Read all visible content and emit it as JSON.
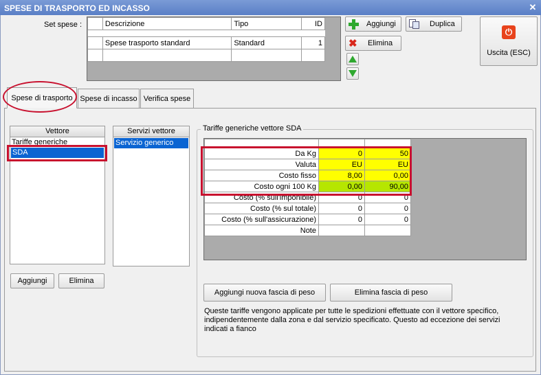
{
  "window": {
    "title": "SPESE DI TRASPORTO ED INCASSO",
    "close_glyph": "✕"
  },
  "set_spese": {
    "label": "Set spese :",
    "columns": [
      "Descrizione",
      "Tipo",
      "ID"
    ],
    "rows": [
      {
        "descrizione": "Spese trasporto standard",
        "tipo": "Standard",
        "id": "1"
      }
    ]
  },
  "toolbar": {
    "add_label": "Aggiungi",
    "duplicate_label": "Duplica",
    "delete_label": "Elimina",
    "exit_label": "Uscita (ESC)"
  },
  "tabs": [
    "Spese di trasporto",
    "Spese di incasso",
    "Verifica spese"
  ],
  "vettore": {
    "header": "Vettore",
    "items": [
      "Tariffe generiche",
      "SDA"
    ],
    "add_label": "Aggiungi",
    "delete_label": "Elimina"
  },
  "servizi": {
    "header": "Servizi vettore",
    "items": [
      "Servizio generico"
    ]
  },
  "tariffe": {
    "group_title": "Tariffe generiche vettore SDA",
    "rows": [
      {
        "label": "Da Kg",
        "v1": "0",
        "v2": "50"
      },
      {
        "label": "Valuta",
        "v1": "EU",
        "v2": "EU"
      },
      {
        "label": "Costo fisso",
        "v1": "8,00",
        "v2": "0,00"
      },
      {
        "label": "Costo ogni 100 Kg",
        "v1": "0,00",
        "v2": "90,00"
      },
      {
        "label": "Costo (% sull'imponibile)",
        "v1": "0",
        "v2": "0"
      },
      {
        "label": "Costo (% sul totale)",
        "v1": "0",
        "v2": "0"
      },
      {
        "label": "Costo (% sull'assicurazione)",
        "v1": "0",
        "v2": "0"
      },
      {
        "label": "Note",
        "v1": "",
        "v2": ""
      }
    ],
    "add_band_label": "Aggiungi nuova fascia di peso",
    "delete_band_label": "Elimina fascia di peso",
    "note_text": "Queste tariffe vengono applicate per tutte le spedizioni effettuate con il vettore specifico, indipendentemente dalla zona e dal servizio specificato. Questo ad eccezione dei servizi indicati a fianco"
  },
  "icons": {
    "add": "plus-icon",
    "duplicate": "duplicate-icon",
    "delete": "delete-x-icon",
    "up": "arrow-up-icon",
    "down": "arrow-down-icon",
    "exit": "power-icon"
  },
  "colors": {
    "highlight_yellow": "#ffff00",
    "highlight_green": "#b6e600",
    "selection_blue": "#0a64d2",
    "annotation_red": "#c8102e"
  }
}
